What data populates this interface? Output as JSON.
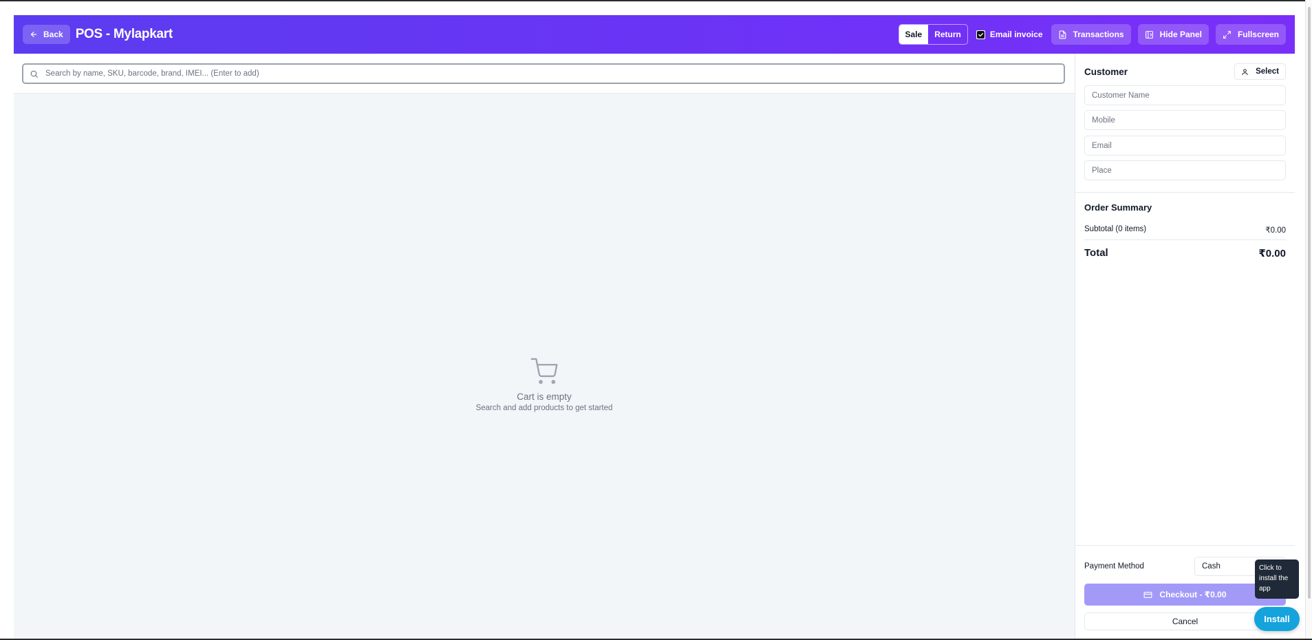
{
  "header": {
    "back_label": "Back",
    "title": "POS - Mylapkart",
    "mode_sale": "Sale",
    "mode_return": "Return",
    "email_invoice_label": "Email invoice",
    "email_invoice_checked": true,
    "transactions_label": "Transactions",
    "hide_panel_label": "Hide Panel",
    "fullscreen_label": "Fullscreen"
  },
  "search": {
    "placeholder": "Search by name, SKU, barcode, brand, IMEI... (Enter to add)"
  },
  "cart": {
    "empty_title": "Cart is empty",
    "empty_subtitle": "Search and add products to get started"
  },
  "customer": {
    "title": "Customer",
    "select_label": "Select",
    "name_placeholder": "Customer Name",
    "mobile_placeholder": "Mobile",
    "email_placeholder": "Email",
    "place_placeholder": "Place"
  },
  "summary": {
    "title": "Order Summary",
    "subtotal_label": "Subtotal (0 items)",
    "subtotal_value": "₹0.00",
    "total_label": "Total",
    "total_value": "₹0.00"
  },
  "payment": {
    "method_label": "Payment Method",
    "method_value": "Cash",
    "checkout_label": "Checkout - ₹0.00",
    "cancel_label": "Cancel"
  },
  "pwa": {
    "tooltip": "Click to install the app",
    "install_label": "Install"
  },
  "colors": {
    "header_gradient_start": "#5b3cf0",
    "header_gradient_end": "#7a2ff8",
    "checkout_bg": "#a39af8",
    "install_bg": "#14a3dd"
  }
}
